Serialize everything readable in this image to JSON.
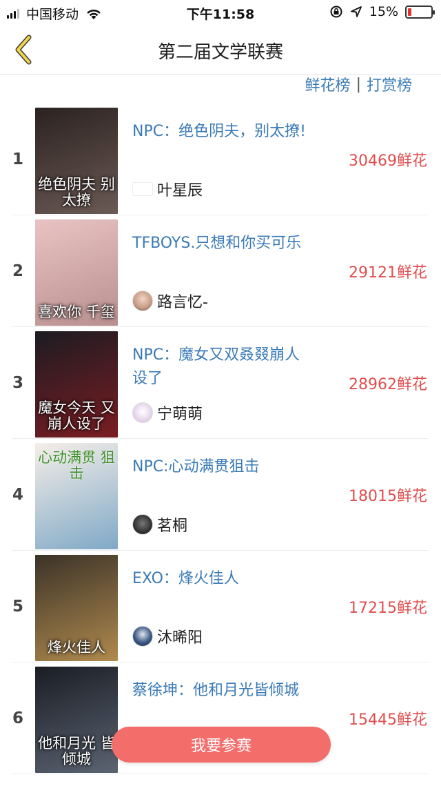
{
  "status_bar": {
    "carrier": "中国移动",
    "time": "下午11:58",
    "battery_text": "15%",
    "battery_level": 0.15
  },
  "nav": {
    "title": "第二届文学联赛",
    "back_icon": "chevron-left-icon"
  },
  "rank_types": {
    "flowers": "鲜花榜",
    "separator": "|",
    "rewards": "打赏榜"
  },
  "rankings": [
    {
      "rank": "1",
      "title": "NPC：绝色阴夫，别太撩!",
      "author": "叶星辰",
      "flowers": "30469鲜花",
      "cover_text": "绝色阴夫 别太撩",
      "cover_colors": [
        "#2b2220",
        "#6b5a55"
      ]
    },
    {
      "rank": "2",
      "title": "TFBOYS.只想和你买可乐",
      "author": "路言忆-",
      "flowers": "29121鲜花",
      "cover_text": "喜欢你 千玺",
      "cover_colors": [
        "#e9c3c3",
        "#b98f8f"
      ]
    },
    {
      "rank": "3",
      "title": "NPC：魔女又双叒叕崩人设了",
      "author": "宁萌萌",
      "flowers": "28962鲜花",
      "cover_text": "魔女今天 又崩人设了",
      "cover_colors": [
        "#1c1c22",
        "#7a1d22"
      ]
    },
    {
      "rank": "4",
      "title": "NPC:心动满贯狙击",
      "author": "茗桐",
      "flowers": "18015鲜花",
      "cover_text": "心动满贯 狙击",
      "cover_colors": [
        "#f6eee8",
        "#7fa9c6"
      ]
    },
    {
      "rank": "5",
      "title": "EXO：烽火佳人",
      "author": "沐晞阳",
      "flowers": "17215鲜花",
      "cover_text": "烽火佳人",
      "cover_colors": [
        "#3b3328",
        "#b08a4e"
      ]
    },
    {
      "rank": "6",
      "title": "蔡徐坤：他和月光皆倾城",
      "author": "",
      "flowers": "15445鲜花",
      "cover_text": "他和月光 皆倾城",
      "cover_colors": [
        "#1a1d24",
        "#5b6472"
      ]
    }
  ],
  "join_button": "我要参赛"
}
